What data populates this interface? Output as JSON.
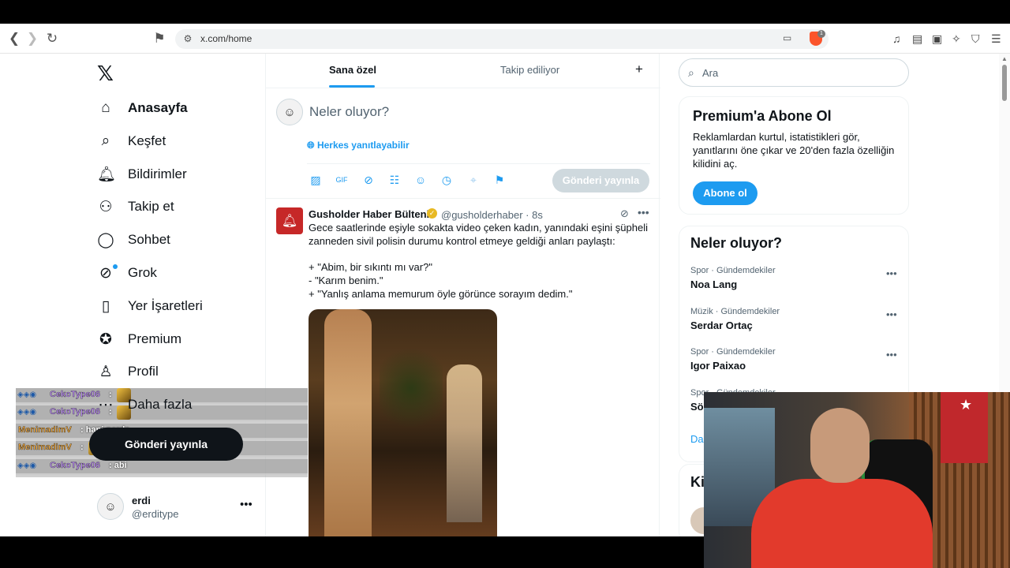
{
  "browser": {
    "url": "x.com/home",
    "brave_badge": "1"
  },
  "sidebar": {
    "items": [
      {
        "label": "Anasayfa",
        "icon": "home-icon"
      },
      {
        "label": "Keşfet",
        "icon": "search-icon"
      },
      {
        "label": "Bildirimler",
        "icon": "bell-icon"
      },
      {
        "label": "Takip et",
        "icon": "follow-icon"
      },
      {
        "label": "Sohbet",
        "icon": "chat-icon"
      },
      {
        "label": "Grok",
        "icon": "grok-icon"
      },
      {
        "label": "Yer İşaretleri",
        "icon": "bookmark-icon"
      },
      {
        "label": "Premium",
        "icon": "verified-icon"
      },
      {
        "label": "Profil",
        "icon": "profile-icon"
      },
      {
        "label": "Daha fazla",
        "icon": "more-circle-icon"
      }
    ],
    "post_button": "Gönderi yayınla",
    "user": {
      "name": "erdi",
      "handle": "@erditype"
    }
  },
  "feed": {
    "tabs": [
      "Sana özel",
      "Takip ediliyor"
    ],
    "composer": {
      "placeholder": "Neler oluyor?",
      "reply_setting": "Herkes yanıtlayabilir",
      "post_button": "Gönderi yayınla"
    },
    "tweet": {
      "name": "Gusholder Haber Bülteni",
      "handle": "@gusholderhaber · 8s",
      "text": "Gece saatlerinde eşiyle sokakta video çeken kadın, yanındaki eşini şüpheli zanneden sivil polisin durumu kontrol etmeye geldiği anları paylaştı:\n\n+ \"Abim, bir sıkıntı mı var?\"\n- \"Karım benim.\"\n+ \"Yanlış anlama memurum öyle görünce sorayım dedim.\""
    }
  },
  "right": {
    "search_placeholder": "Ara",
    "premium": {
      "title": "Premium'a Abone Ol",
      "desc": "Reklamlardan kurtul, istatistikleri gör, yanıtlarını öne çıkar ve 20'den fazla özelliğin kilidini aç.",
      "button": "Abone ol"
    },
    "trends_title": "Neler oluyor?",
    "trends": [
      {
        "category": "Spor · Gündemdekiler",
        "name": "Noa Lang"
      },
      {
        "category": "Müzik · Gündemdekiler",
        "name": "Serdar Ortaç"
      },
      {
        "category": "Spor · Gündemdekiler",
        "name": "Igor Paixao"
      },
      {
        "category": "Spor · Gündemdekiler",
        "name": "Sö"
      }
    ],
    "show_more": "Da",
    "who_title": "Ki"
  },
  "chat": {
    "messages": [
      {
        "user": "CekoType06",
        "message": ":",
        "color": "#b88af0"
      },
      {
        "user": "CekoType06",
        "message": ":",
        "color": "#b88af0"
      },
      {
        "user": "MenimadimV",
        "message": ": hani nerde",
        "color": "#e8a23a"
      },
      {
        "user": "MenimadimV",
        "message": ":",
        "color": "#e8a23a"
      },
      {
        "user": "CekoType06",
        "message": ": abi",
        "color": "#b88af0"
      }
    ]
  },
  "colors": {
    "accent": "#1d9bf0",
    "text": "#0f1419",
    "muted": "#536471"
  }
}
